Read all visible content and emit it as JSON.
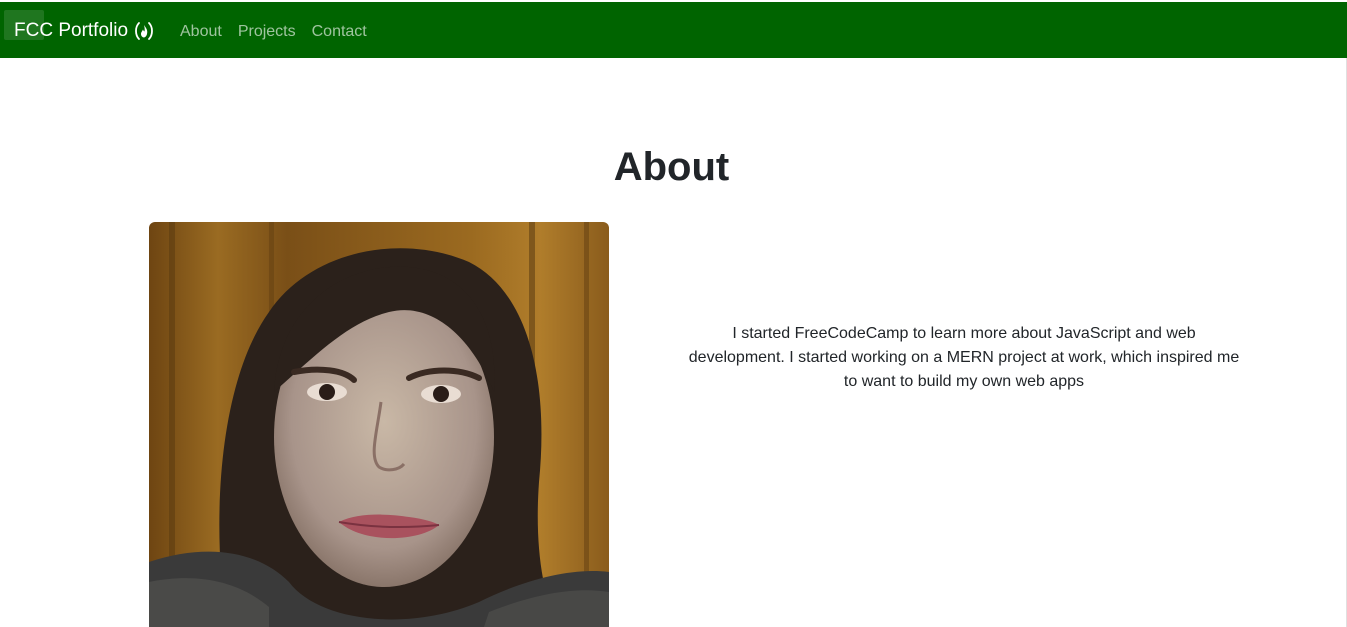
{
  "navbar": {
    "brand": "FCC Portfolio",
    "brand_icon": "freecodecamp-flame-icon",
    "background": "#006400",
    "links": [
      {
        "label": "About"
      },
      {
        "label": "Projects"
      },
      {
        "label": "Contact"
      }
    ]
  },
  "about": {
    "title": "About",
    "photo_alt": "profile-photo",
    "description": "I started FreeCodeCamp to learn more about JavaScript and web development. I started working on a MERN project at work, which inspired me to want to build my own web apps"
  }
}
